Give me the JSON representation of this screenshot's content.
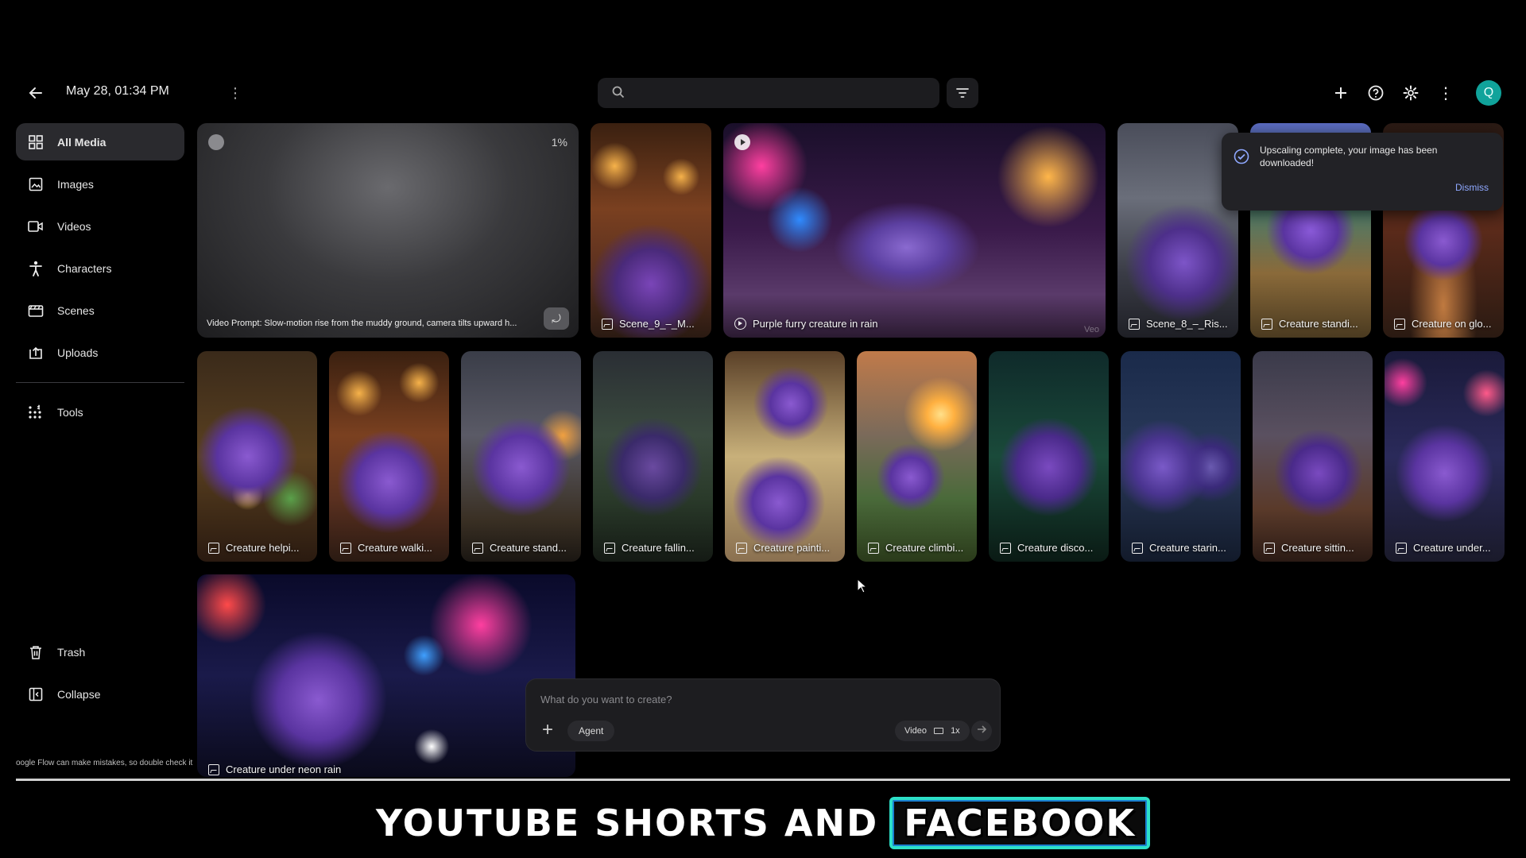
{
  "header": {
    "date": "May 28, 01:34 PM",
    "search_placeholder": "",
    "avatar_letter": "Q"
  },
  "sidebar": {
    "items": [
      {
        "label": "All Media",
        "icon": "grid-icon",
        "active": true
      },
      {
        "label": "Images",
        "icon": "image-icon"
      },
      {
        "label": "Videos",
        "icon": "video-icon"
      },
      {
        "label": "Characters",
        "icon": "character-icon"
      },
      {
        "label": "Scenes",
        "icon": "scene-icon"
      },
      {
        "label": "Uploads",
        "icon": "upload-icon"
      }
    ],
    "tools": "Tools",
    "trash": "Trash",
    "collapse": "Collapse",
    "disclaimer": "oogle Flow can make mistakes, so double check it"
  },
  "media": {
    "generating": {
      "progress": "1%",
      "prompt": "Video Prompt: Slow-motion rise from the muddy ground, camera tilts upward h..."
    },
    "row1": [
      {
        "label": "Scene_9_–_M...",
        "type": "image"
      },
      {
        "label": "Purple furry creature in rain",
        "type": "video",
        "badge": "Veo"
      },
      {
        "label": "Scene_8_–_Ris...",
        "type": "image"
      },
      {
        "label": "Creature standi...",
        "type": "image"
      },
      {
        "label": "Creature on glo...",
        "type": "image"
      }
    ],
    "row2": [
      {
        "label": "Creature helpi..."
      },
      {
        "label": "Creature walki..."
      },
      {
        "label": "Creature stand..."
      },
      {
        "label": "Creature fallin..."
      },
      {
        "label": "Creature painti..."
      },
      {
        "label": "Creature climbi..."
      },
      {
        "label": "Creature disco..."
      },
      {
        "label": "Creature starin..."
      },
      {
        "label": "Creature sittin..."
      },
      {
        "label": "Creature under..."
      }
    ],
    "row3": [
      {
        "label": "Creature under neon rain"
      }
    ]
  },
  "toast": {
    "message": "Upscaling complete, your image has been downloaded!",
    "dismiss": "Dismiss"
  },
  "prompt_box": {
    "placeholder": "What do you want to create?",
    "agent": "Agent",
    "mode": "Video",
    "ratio_icon": "landscape-icon",
    "count": "1x"
  },
  "caption": {
    "part1": "YOUTUBE SHORTS AND",
    "part2": "FACEBOOK"
  },
  "colors": {
    "accent_teal": "#2de0c8",
    "avatar": "#10a39b",
    "dismiss_link": "#8fa8ff"
  }
}
